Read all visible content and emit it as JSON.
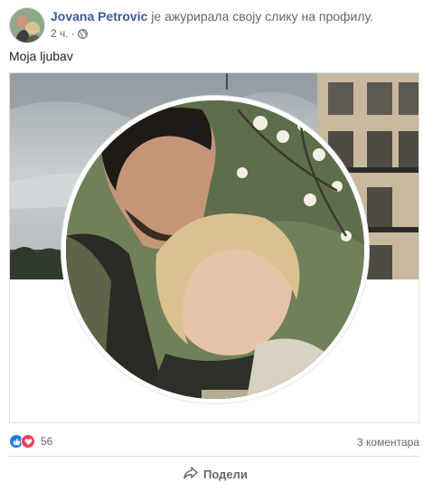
{
  "post": {
    "author_name": "Jovana Petrovic",
    "action_text": "је ажурирала своју слику на профилу.",
    "timestamp": "2 ч.",
    "privacy_icon": "globe-icon",
    "caption": "Moja ljubav"
  },
  "stats": {
    "reaction_icons": [
      "like-icon",
      "love-icon"
    ],
    "reaction_count": "56",
    "comments": "3 коментара"
  },
  "actions": {
    "share_label": "Подели",
    "share_icon": "share-arrow-icon"
  },
  "colors": {
    "name": "#385898",
    "like": "#2078f4",
    "love": "#f33e58"
  }
}
